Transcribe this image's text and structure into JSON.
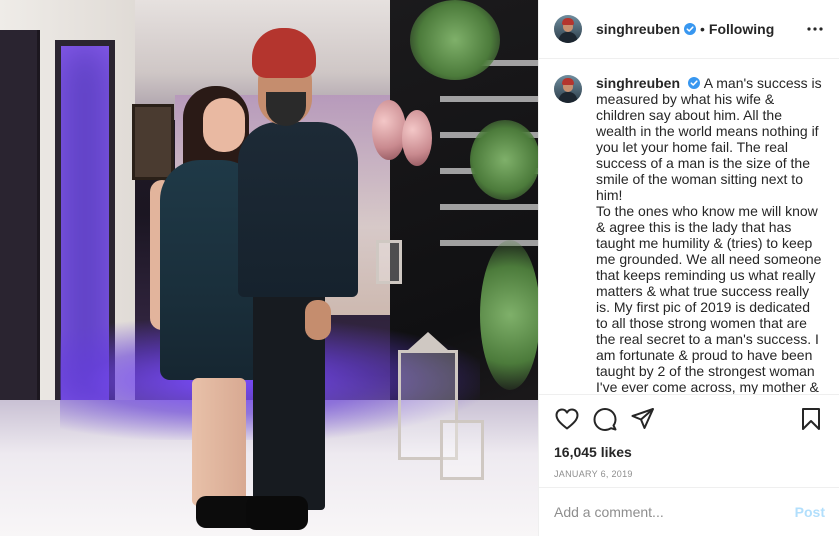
{
  "post": {
    "header": {
      "username": "singhreuben",
      "separator": "•",
      "follow_label": "Following"
    },
    "caption": {
      "username": "singhreuben",
      "text": "A man's success is measured by what his wife & children say about him. All the wealth in the world means nothing if you let your home fail. The real success of a man is the size of the smile of the woman sitting next to him!\nTo the ones who know me will know & agree this is the lady that has taught me humility & (tries) to keep me grounded. We all need someone that keeps reminding us what really matters & what true success really is. My first pic of 2019 is dedicated to all those strong women that are the real secret to a man's success. I am fortunate & proud to have been taught by 2 of the strongest woman I've ever come across, my mother & my wife."
    },
    "likes_text": "16,045 likes",
    "date": "JANUARY 6, 2019",
    "comment": {
      "placeholder": "Add a comment...",
      "post_label": "Post"
    },
    "icons": {
      "like": "heart-icon",
      "comment": "comment-icon",
      "share": "share-icon",
      "save": "bookmark-icon",
      "more": "more-options-icon",
      "verified": "verified-badge-icon"
    },
    "colors": {
      "verified": "#3897f0",
      "post_button": "#b2dffc",
      "muted_text": "#8e8e8e"
    }
  }
}
